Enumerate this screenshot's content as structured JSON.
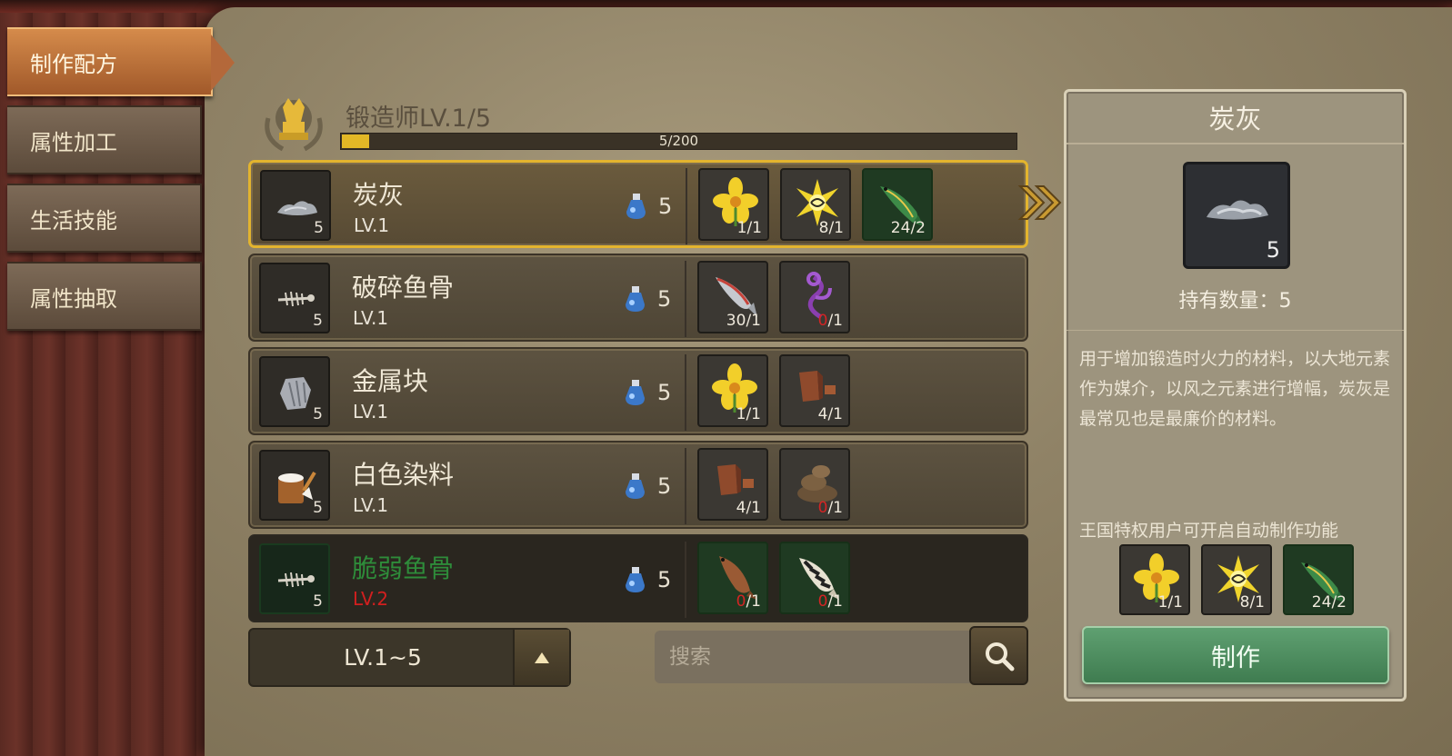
{
  "tabs": [
    {
      "label": "制作配方",
      "active": true
    },
    {
      "label": "属性加工",
      "active": false
    },
    {
      "label": "生活技能",
      "active": false
    },
    {
      "label": "属性抽取",
      "active": false
    }
  ],
  "skill": {
    "title": "锻造师LV.1/5",
    "xp_text": "5/200",
    "xp_fraction": 0.04
  },
  "recipes": [
    {
      "name": "炭灰",
      "level": "LV.1",
      "count": "5",
      "energy": "5",
      "icon": "ash-icon",
      "materials": [
        {
          "icon": "yellow-flower-icon",
          "have": "1",
          "need": "1",
          "lack": false,
          "green": false
        },
        {
          "icon": "spark-icon",
          "have": "8",
          "need": "1",
          "lack": false,
          "green": false
        },
        {
          "icon": "green-fish-icon",
          "have": "24",
          "need": "2",
          "lack": false,
          "green": true
        }
      ]
    },
    {
      "name": "破碎鱼骨",
      "level": "LV.1",
      "count": "5",
      "energy": "5",
      "icon": "fish-bone-icon",
      "materials": [
        {
          "icon": "sardine-icon",
          "have": "30",
          "need": "1",
          "lack": false,
          "green": false
        },
        {
          "icon": "purple-vine-icon",
          "have": "0",
          "need": "1",
          "lack": true,
          "green": false
        }
      ]
    },
    {
      "name": "金属块",
      "level": "LV.1",
      "count": "5",
      "energy": "5",
      "icon": "metal-lump-icon",
      "materials": [
        {
          "icon": "yellow-flower-icon",
          "have": "1",
          "need": "1",
          "lack": false,
          "green": false
        },
        {
          "icon": "wood-chunk-icon",
          "have": "4",
          "need": "1",
          "lack": false,
          "green": false
        }
      ]
    },
    {
      "name": "白色染料",
      "level": "LV.1",
      "count": "5",
      "energy": "5",
      "icon": "paint-bucket-icon",
      "materials": [
        {
          "icon": "wood-chunk-icon",
          "have": "4",
          "need": "1",
          "lack": false,
          "green": false
        },
        {
          "icon": "dirt-pile-icon",
          "have": "0",
          "need": "1",
          "lack": true,
          "green": false
        }
      ]
    },
    {
      "name": "脆弱鱼骨",
      "level": "LV.2",
      "count": "5",
      "energy": "5",
      "icon": "fish-bone-icon",
      "locked": true,
      "materials": [
        {
          "icon": "brown-fish-icon",
          "have": "0",
          "need": "1",
          "lack": true,
          "green": true
        },
        {
          "icon": "striped-fish-icon",
          "have": "0",
          "need": "1",
          "lack": true,
          "green": true
        }
      ]
    }
  ],
  "filter": {
    "level_range": "LV.1~5"
  },
  "search": {
    "placeholder": "搜索"
  },
  "detail": {
    "title": "炭灰",
    "count": "5",
    "owned_label": "持有数量：5",
    "description": "用于增加锻造时火力的材料，以大地元素作为媒介，以风之元素进行增幅，炭灰是最常见也是最廉价的材料。",
    "privilege_note": "王国特权用户可开启自动制作功能",
    "materials": [
      {
        "icon": "yellow-flower-icon",
        "have": "1",
        "need": "1",
        "lack": false,
        "green": false
      },
      {
        "icon": "spark-icon",
        "have": "8",
        "need": "1",
        "lack": false,
        "green": false
      },
      {
        "icon": "green-fish-icon",
        "have": "24",
        "need": "2",
        "lack": false,
        "green": true
      }
    ],
    "make_label": "制作"
  },
  "colors": {
    "accent_gold": "#e3b42e",
    "locked_name": "#2e8c3a",
    "locked_level": "#d11f1f",
    "make_button": "#4f8d5f"
  }
}
